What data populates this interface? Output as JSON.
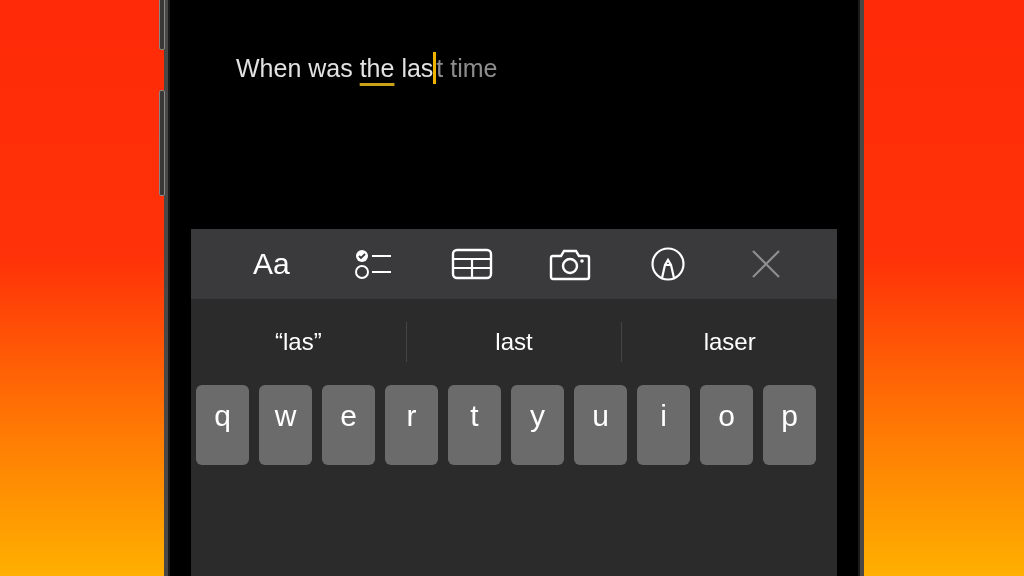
{
  "note": {
    "segments": [
      {
        "text": "When was ",
        "kind": "plain"
      },
      {
        "text": "the",
        "kind": "underlined"
      },
      {
        "text": " las",
        "kind": "plain"
      }
    ],
    "caret": true,
    "inline_prediction": "t time"
  },
  "toolbar": {
    "items": [
      {
        "kind": "text",
        "label": "Aa"
      },
      {
        "kind": "checklist"
      },
      {
        "kind": "table"
      },
      {
        "kind": "camera"
      },
      {
        "kind": "markup"
      },
      {
        "kind": "close"
      }
    ]
  },
  "suggestions": [
    {
      "text": "“las”"
    },
    {
      "text": "last"
    },
    {
      "text": "laser"
    }
  ],
  "keyboard": {
    "keys": [
      "q",
      "w",
      "e",
      "r",
      "t",
      "y",
      "u",
      "i",
      "o",
      "p"
    ]
  }
}
